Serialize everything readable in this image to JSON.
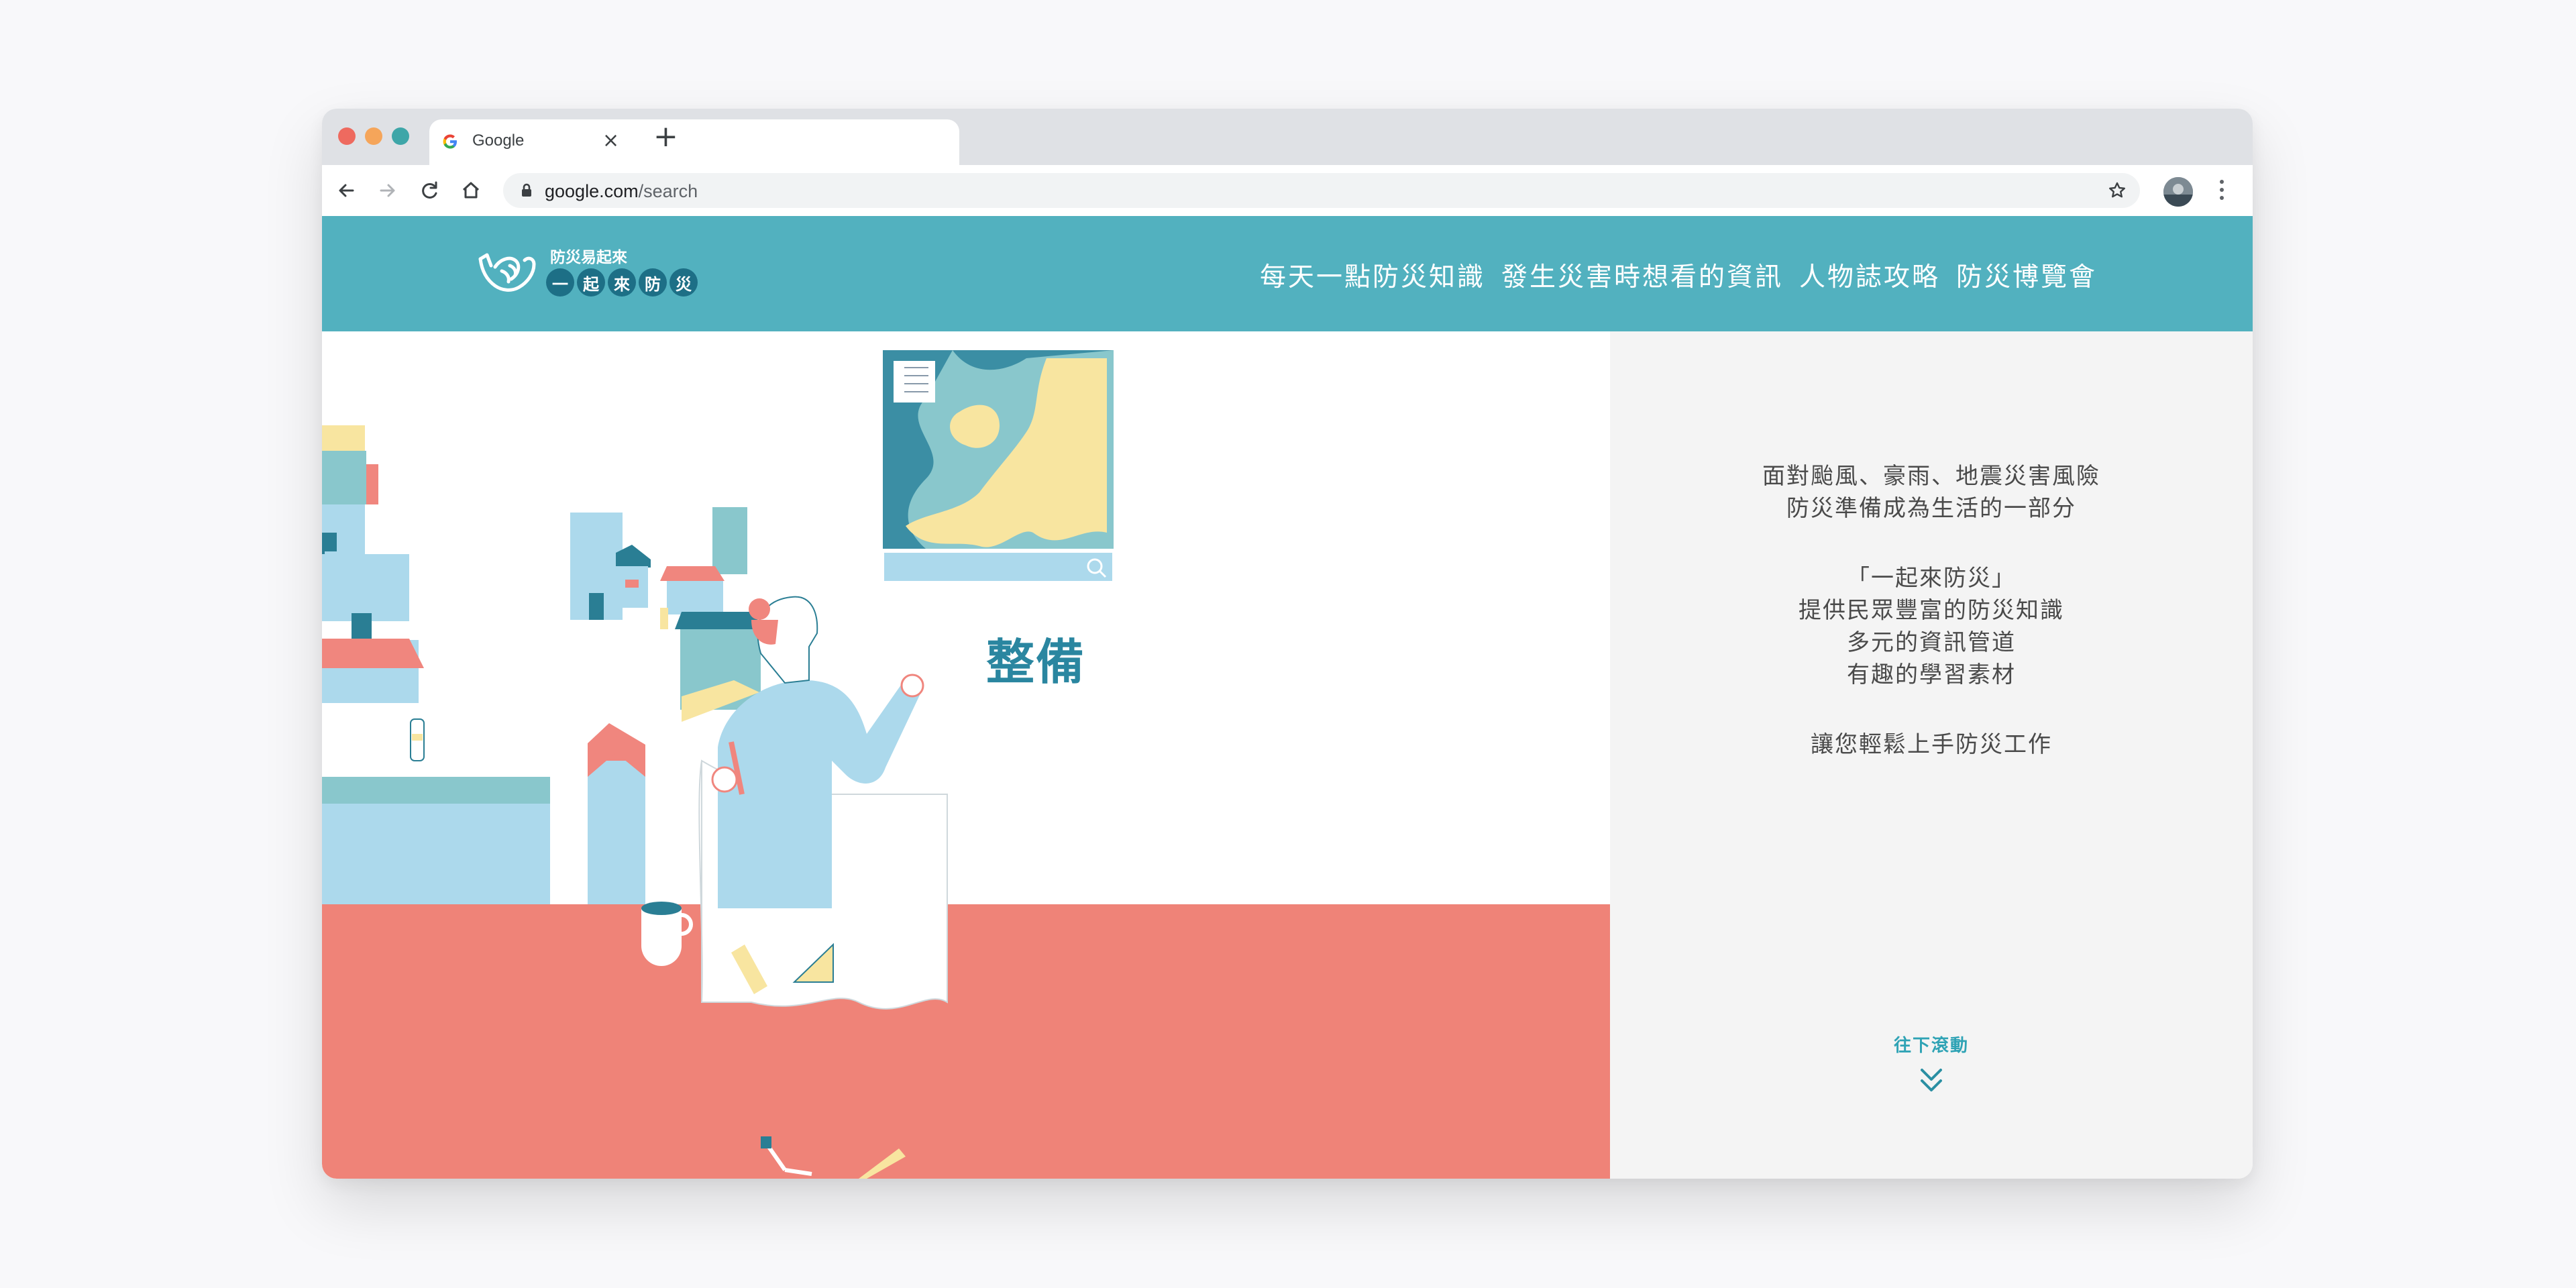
{
  "browser": {
    "tab_title": "Google",
    "url_host": "google.com",
    "url_path": "/search",
    "traffic_colors": [
      "#ee6a5f",
      "#f5a55a",
      "#3ea6a8"
    ]
  },
  "site": {
    "logo_tagline": "防災易起來",
    "logo_chars": [
      "一",
      "起",
      "來",
      "防",
      "災"
    ],
    "nav": [
      "每天一點防災知識",
      "發生災害時想看的資訊",
      "人物誌攻略",
      "防災博覽會"
    ],
    "header_color": "#52b1bf"
  },
  "hero": {
    "label": "整備"
  },
  "intro": {
    "p1_line1": "面對颱風、豪雨、地震災害風險",
    "p1_line2": "防災準備成為生活的一部分",
    "p2_line1": "「一起來防災」",
    "p2_line2": "提供民眾豐富的防災知識",
    "p2_line3": "多元的資訊管道",
    "p2_line4": "有趣的學習素材",
    "p3": "讓您輕鬆上手防災工作",
    "scroll_label": "往下滾動"
  }
}
